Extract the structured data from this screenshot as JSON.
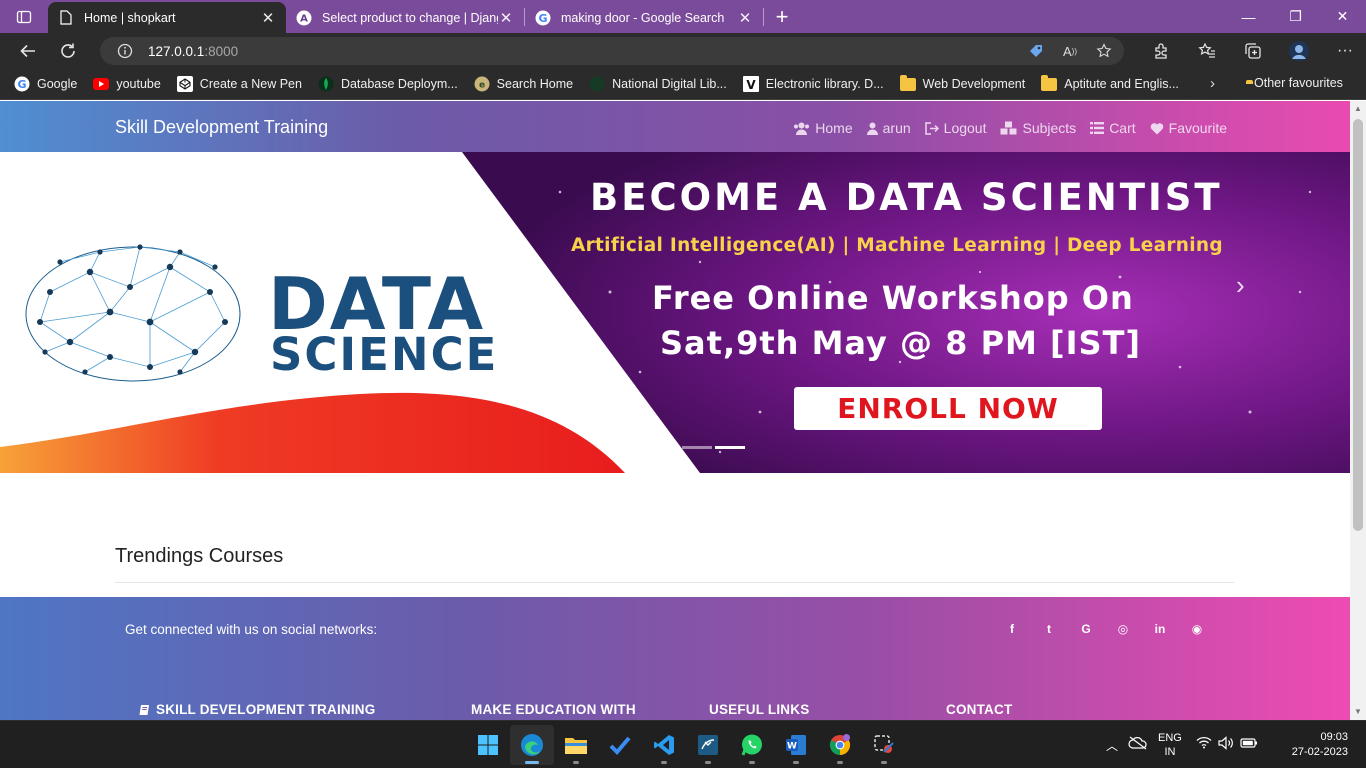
{
  "browser": {
    "tabs": [
      {
        "title": "Home | shopkart",
        "active": true
      },
      {
        "title": "Select product to change | Djang",
        "active": false
      },
      {
        "title": "making door - Google Search",
        "active": false
      }
    ],
    "tab_close_glyph": "✕",
    "new_tab_glyph": "+",
    "address": {
      "host": "127.0.0.1",
      "port": ":8000"
    },
    "favourites": [
      {
        "label": "Google",
        "icon": "google-icon"
      },
      {
        "label": "youtube",
        "icon": "youtube-icon"
      },
      {
        "label": "Create a New Pen",
        "icon": "codepen-icon"
      },
      {
        "label": "Database Deploym...",
        "icon": "mongodb-icon"
      },
      {
        "label": "Search Home",
        "icon": "search-home-icon"
      },
      {
        "label": "National Digital Lib...",
        "icon": "ndl-icon"
      },
      {
        "label": "Electronic library. D...",
        "icon": "vlib-icon"
      },
      {
        "label": "Web Development",
        "icon": "folder-icon"
      },
      {
        "label": "Aptitute and Englis...",
        "icon": "folder-icon"
      }
    ],
    "other_favourites": "Other favourites"
  },
  "site": {
    "brand": "Skill Development Training",
    "nav": [
      {
        "label": "Home",
        "icon": "users-icon"
      },
      {
        "label": "arun",
        "icon": "user-icon"
      },
      {
        "label": "Logout",
        "icon": "logout-icon"
      },
      {
        "label": "Subjects",
        "icon": "cubes-icon"
      },
      {
        "label": "Cart",
        "icon": "list-icon"
      },
      {
        "label": "Favourite",
        "icon": "heart-icon"
      }
    ],
    "banner": {
      "logo_word1": "DATA",
      "logo_word2": "SCIENCE",
      "headline": "BECOME A DATA SCIENTIST",
      "tags": "Artificial Intelligence(AI) | Machine Learning | Deep Learning",
      "line1": "Free Online Workshop On",
      "line2": "Sat,9th May @ 8 PM [IST]",
      "cta": "ENROLL NOW",
      "next_glyph": "›"
    },
    "trending_title": "Trendings Courses",
    "footer": {
      "social_text": "Get connected with us on social networks:",
      "social_icons": [
        "facebook-icon",
        "twitter-icon",
        "google-icon",
        "instagram-icon",
        "linkedin-icon",
        "github-icon"
      ],
      "social_glyphs": [
        "f",
        "t",
        "G",
        "◎",
        "in",
        "◉"
      ],
      "columns": [
        "SKILL DEVELOPMENT TRAINING",
        "MAKE EDUCATION WITH",
        "USEFUL LINKS",
        "CONTACT"
      ]
    }
  },
  "taskbar": {
    "apps": [
      "start-icon",
      "edge-icon",
      "file-explorer-icon",
      "todo-icon",
      "vscode-icon",
      "mysql-workbench-icon",
      "whatsapp-icon",
      "word-icon",
      "chrome-icon",
      "snipping-tool-icon"
    ],
    "lang_line1": "ENG",
    "lang_line2": "IN",
    "time": "09:03",
    "date": "27-02-2023"
  },
  "colors": {
    "tab_strip": "#7b4b9b",
    "chrome_dark": "#2b2b2b",
    "navbar_gradient": [
      "#4f8fd2",
      "#8a4fa6",
      "#e94bb0"
    ],
    "banner_title_blue": "#1b4f7e",
    "enroll_red": "#e0161e",
    "tag_yellow": "#f7d24a"
  }
}
